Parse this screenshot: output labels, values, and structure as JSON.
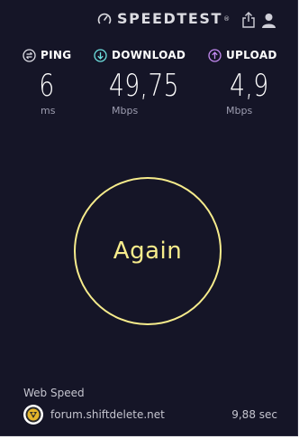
{
  "header": {
    "app_name": "SPEEDTEST",
    "trademark": "®",
    "icons": [
      "speedometer-icon",
      "share-icon",
      "user-icon"
    ]
  },
  "metrics": {
    "ping": {
      "label": "PING",
      "value": "6",
      "unit": "ms",
      "icon": "ping-icon"
    },
    "download": {
      "label": "DOWNLOAD",
      "value": "49,75",
      "unit": "Mbps",
      "icon": "download-arrow-icon"
    },
    "upload": {
      "label": "UPLOAD",
      "value": "4,9",
      "unit": "Mbps",
      "icon": "upload-arrow-icon"
    }
  },
  "action": {
    "label": "Again"
  },
  "footer": {
    "title": "Web Speed",
    "server": "forum.shiftdelete.net",
    "duration": "9,88 sec"
  },
  "colors": {
    "background": "#151527",
    "ping_accent": "#e0e0e8",
    "download_accent": "#6fe3e1",
    "upload_accent": "#c58bf2",
    "button": "#f7ec8c"
  }
}
